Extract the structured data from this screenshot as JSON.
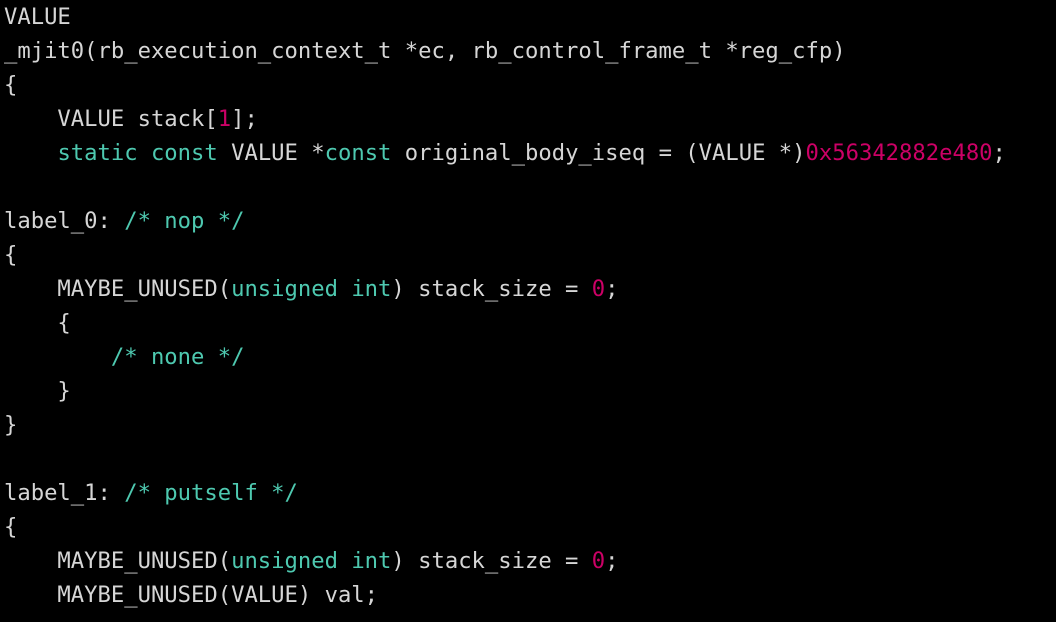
{
  "code": {
    "l01_a": "VALUE",
    "l02_a": "_mjit0(rb_execution_context_t *ec, rb_control_frame_t *reg_cfp)",
    "l03_a": "{",
    "l04_a": "    VALUE stack[",
    "l04_b": "1",
    "l04_c": "];",
    "l05_a": "    ",
    "l05_b": "static",
    "l05_c": " ",
    "l05_d": "const",
    "l05_e": " VALUE *",
    "l05_f": "const",
    "l05_g": " original_body_iseq = (VALUE *)",
    "l05_h": "0x56342882e480",
    "l05_i": ";",
    "l06_a": "",
    "l07_a": "label_0: ",
    "l07_b": "/* nop */",
    "l08_a": "{",
    "l09_a": "    MAYBE_UNUSED(",
    "l09_b": "unsigned",
    "l09_c": " ",
    "l09_d": "int",
    "l09_e": ") stack_size = ",
    "l09_f": "0",
    "l09_g": ";",
    "l10_a": "    {",
    "l11_a": "        ",
    "l11_b": "/* none */",
    "l12_a": "    }",
    "l13_a": "}",
    "l14_a": "",
    "l15_a": "label_1: ",
    "l15_b": "/* putself */",
    "l16_a": "{",
    "l17_a": "    MAYBE_UNUSED(",
    "l17_b": "unsigned",
    "l17_c": " ",
    "l17_d": "int",
    "l17_e": ") stack_size = ",
    "l17_f": "0",
    "l17_g": ";",
    "l18_a": "    MAYBE_UNUSED(VALUE) val;"
  }
}
